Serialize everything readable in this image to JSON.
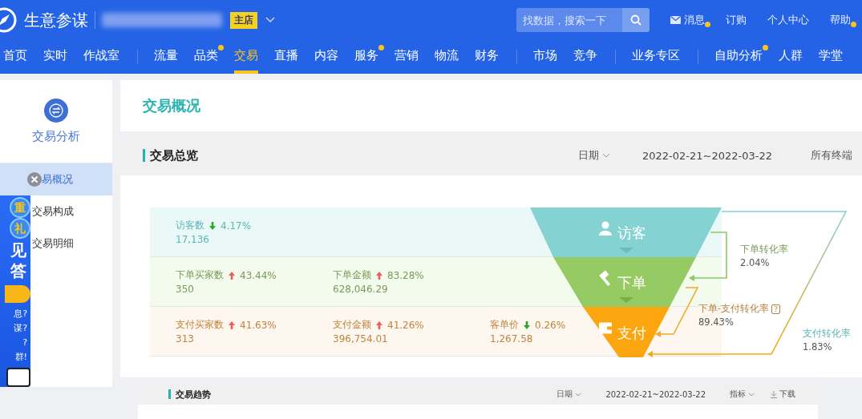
{
  "header": {
    "title": "生意参谋",
    "shop_badge": "主店",
    "search": {
      "placeholder": "找数据，搜索一下"
    },
    "links": [
      {
        "label": "消息",
        "kind": "mail",
        "dot": true
      },
      {
        "label": "订购",
        "kind": "plain",
        "dot": false
      },
      {
        "label": "个人中心",
        "kind": "plain",
        "dot": false
      },
      {
        "label": "帮助",
        "kind": "plain",
        "dot": true
      }
    ]
  },
  "nav": [
    {
      "items": [
        {
          "label": "首页",
          "selected": false,
          "dot": false
        },
        {
          "label": "实时",
          "selected": false,
          "dot": false
        },
        {
          "label": "作战室",
          "selected": false,
          "dot": false
        }
      ]
    },
    {
      "items": [
        {
          "label": "流量",
          "selected": false,
          "dot": false
        },
        {
          "label": "品类",
          "selected": false,
          "dot": true
        },
        {
          "label": "交易",
          "selected": true,
          "dot": false
        },
        {
          "label": "直播",
          "selected": false,
          "dot": false
        },
        {
          "label": "内容",
          "selected": false,
          "dot": false
        },
        {
          "label": "服务",
          "selected": false,
          "dot": true
        },
        {
          "label": "营销",
          "selected": false,
          "dot": false
        },
        {
          "label": "物流",
          "selected": false,
          "dot": false
        },
        {
          "label": "财务",
          "selected": false,
          "dot": false
        }
      ]
    },
    {
      "items": [
        {
          "label": "市场",
          "selected": false,
          "dot": false
        },
        {
          "label": "竞争",
          "selected": false,
          "dot": false
        }
      ]
    },
    {
      "items": [
        {
          "label": "业务专区",
          "selected": false,
          "dot": false
        }
      ]
    },
    {
      "items": [
        {
          "label": "自助分析",
          "selected": false,
          "dot": true
        },
        {
          "label": "人群",
          "selected": false,
          "dot": false
        },
        {
          "label": "学堂",
          "selected": false,
          "dot": false
        }
      ]
    }
  ],
  "sidebar": {
    "title": "交易分析",
    "items": [
      {
        "label": "易概况",
        "selected": true
      },
      {
        "label": "交易构成",
        "selected": false
      },
      {
        "label": "交易明细",
        "selected": false
      }
    ]
  },
  "ad_banner": {
    "badges": [
      "重",
      "礼"
    ],
    "headline": [
      "见",
      "答"
    ],
    "lines": [
      "息?",
      "谋?",
      "?",
      "群!"
    ]
  },
  "page_title": "交易概况",
  "overview": {
    "title": "交易总览",
    "date_label": "日期",
    "date_range": "2022-02-21~2022-03-22",
    "terminal": "所有终端",
    "stages": [
      {
        "kind": "visitor",
        "label": "访客",
        "metrics": [
          {
            "name": "访客数",
            "rising": false,
            "change": "4.17%",
            "value": "17,136"
          }
        ]
      },
      {
        "kind": "order",
        "label": "下单",
        "metrics": [
          {
            "name": "下单买家数",
            "rising": true,
            "change": "43.44%",
            "value": "350"
          },
          {
            "name": "下单金额",
            "rising": true,
            "change": "83.28%",
            "value": "628,046.29"
          }
        ]
      },
      {
        "kind": "pay",
        "label": "支付",
        "metrics": [
          {
            "name": "支付买家数",
            "rising": true,
            "change": "41.63%",
            "value": "313"
          },
          {
            "name": "支付金额",
            "rising": true,
            "change": "41.26%",
            "value": "396,754.01"
          },
          {
            "name": "客单价",
            "rising": false,
            "change": "0.26%",
            "value": "1,267.58"
          }
        ]
      }
    ],
    "conversions": [
      {
        "label": "下单转化率",
        "value": "2.04%"
      },
      {
        "label": "下单-支付转化率",
        "value": "89.43%",
        "help_icon": "?"
      },
      {
        "label": "支付转化率",
        "value": "1.83%"
      }
    ]
  },
  "trend": {
    "title": "交易趋势",
    "date_label": "日期",
    "date_range": "2022-02-21~2022-03-22",
    "metric_label": "指标",
    "download": "下载"
  }
}
